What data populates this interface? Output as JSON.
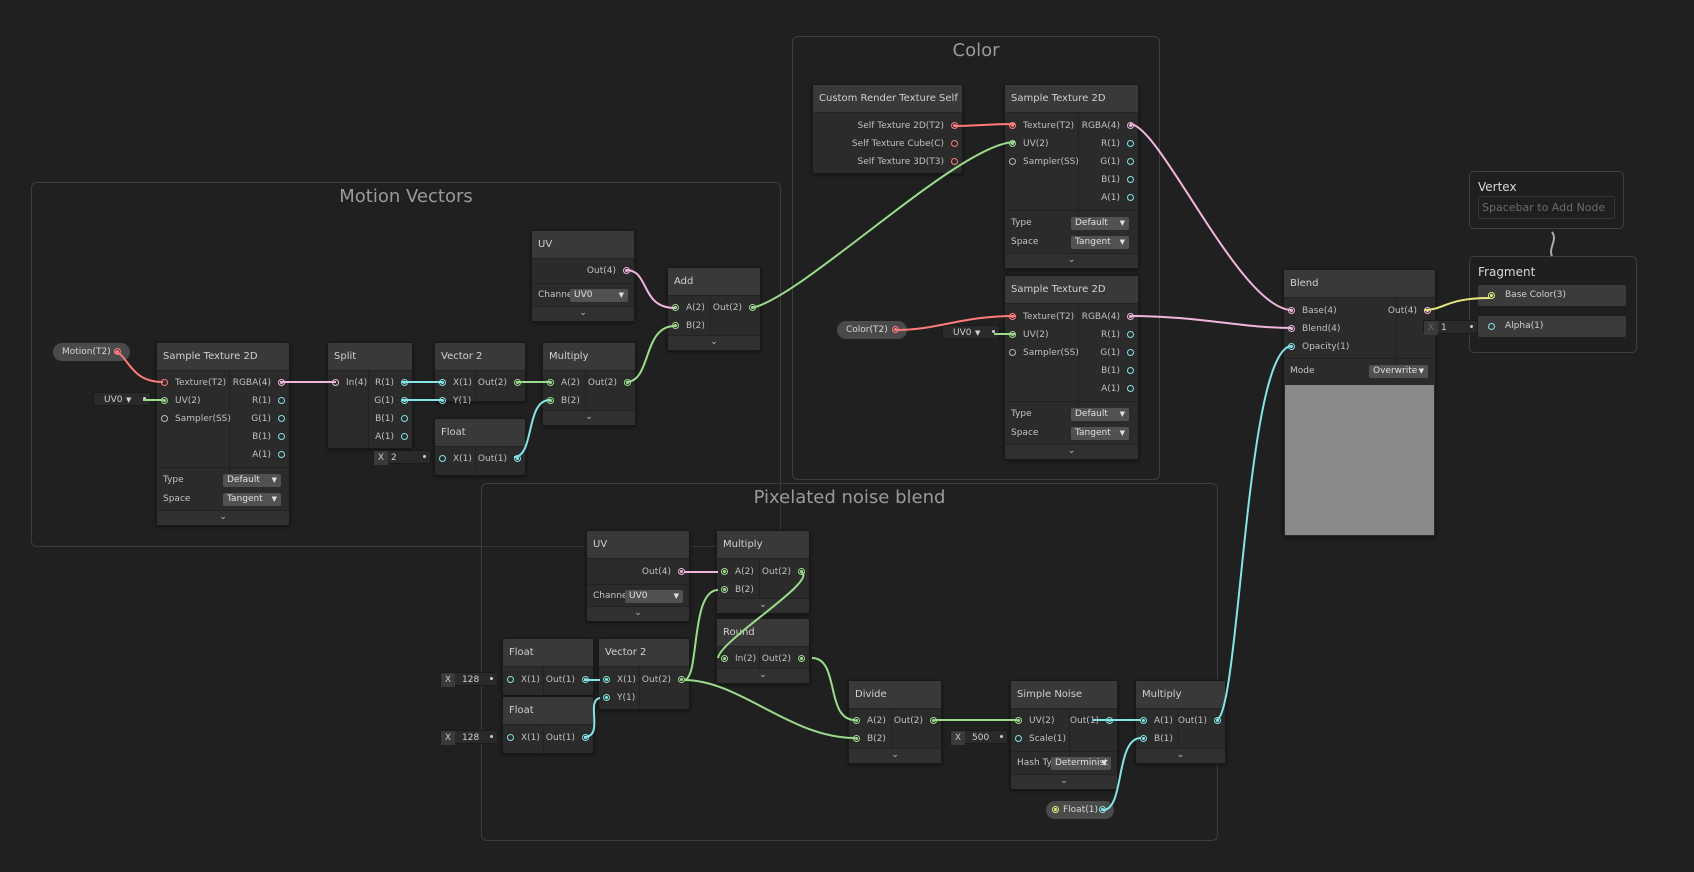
{
  "groups": {
    "motion": "Motion Vectors",
    "color": "Color",
    "pixel": "Pixelated noise blend"
  },
  "colors": {
    "background": "#202020",
    "texture": "#ff7b7b",
    "vector4": "#f0b6de",
    "vector2": "#9bdc8c",
    "vector1": "#84e4e7",
    "vector3": "#e6e87c"
  },
  "icons": {
    "expand": "chevron-down-icon",
    "dropdown": "dropdown-arrow-icon",
    "port": "port-dot-icon"
  },
  "nodes": {
    "motion_sample": {
      "title": "Sample Texture 2D",
      "in": [
        "Texture(T2)",
        "UV(2)",
        "Sampler(SS)"
      ],
      "out": [
        "RGBA(4)",
        "R(1)",
        "G(1)",
        "B(1)",
        "A(1)"
      ],
      "type_label": "Type",
      "type_value": "Default",
      "space_label": "Space",
      "space_value": "Tangent"
    },
    "split": {
      "title": "Split",
      "in": [
        "In(4)"
      ],
      "out": [
        "R(1)",
        "G(1)",
        "B(1)",
        "A(1)"
      ]
    },
    "vec2_a": {
      "title": "Vector 2",
      "in": [
        "X(1)",
        "Y(1)"
      ],
      "out": [
        "Out(2)"
      ]
    },
    "float_a": {
      "title": "Float",
      "in": [
        "X(1)"
      ],
      "out": [
        "Out(1)"
      ]
    },
    "mult_a": {
      "title": "Multiply",
      "in": [
        "A(2)",
        "B(2)"
      ],
      "out": [
        "Out(2)"
      ]
    },
    "uv_a": {
      "title": "UV",
      "out": [
        "Out(4)"
      ],
      "channel_label": "Channe",
      "channel_value": "UV0"
    },
    "add": {
      "title": "Add",
      "in": [
        "A(2)",
        "B(2)"
      ],
      "out": [
        "Out(2)"
      ]
    },
    "crt_self": {
      "title": "Custom Render Texture Self",
      "out": [
        "Self Texture 2D(T2)",
        "Self Texture Cube(C)",
        "Self Texture 3D(T3)"
      ]
    },
    "color_sample1": {
      "title": "Sample Texture 2D",
      "in": [
        "Texture(T2)",
        "UV(2)",
        "Sampler(SS)"
      ],
      "out": [
        "RGBA(4)",
        "R(1)",
        "G(1)",
        "B(1)",
        "A(1)"
      ],
      "type_label": "Type",
      "type_value": "Default",
      "space_label": "Space",
      "space_value": "Tangent"
    },
    "color_sample2": {
      "title": "Sample Texture 2D",
      "in": [
        "Texture(T2)",
        "UV(2)",
        "Sampler(SS)"
      ],
      "out": [
        "RGBA(4)",
        "R(1)",
        "G(1)",
        "B(1)",
        "A(1)"
      ],
      "type_label": "Type",
      "type_value": "Default",
      "space_label": "Space",
      "space_value": "Tangent"
    },
    "blend": {
      "title": "Blend",
      "in": [
        "Base(4)",
        "Blend(4)",
        "Opacity(1)"
      ],
      "out": [
        "Out(4)"
      ],
      "mode_label": "Mode",
      "mode_value": "Overwrite"
    },
    "uv_b": {
      "title": "UV",
      "out": [
        "Out(4)"
      ],
      "channel_label": "Channe",
      "channel_value": "UV0"
    },
    "mult_b": {
      "title": "Multiply",
      "in": [
        "A(2)",
        "B(2)"
      ],
      "out": [
        "Out(2)"
      ]
    },
    "round": {
      "title": "Round",
      "in": [
        "In(2)"
      ],
      "out": [
        "Out(2)"
      ]
    },
    "float_b": {
      "title": "Float",
      "in": [
        "X(1)"
      ],
      "out": [
        "Out(1)"
      ]
    },
    "float_c": {
      "title": "Float",
      "in": [
        "X(1)"
      ],
      "out": [
        "Out(1)"
      ]
    },
    "vec2_b": {
      "title": "Vector 2",
      "in": [
        "X(1)",
        "Y(1)"
      ],
      "out": [
        "Out(2)"
      ]
    },
    "divide": {
      "title": "Divide",
      "in": [
        "A(2)",
        "B(2)"
      ],
      "out": [
        "Out(2)"
      ]
    },
    "noise": {
      "title": "Simple Noise",
      "in": [
        "UV(2)",
        "Scale(1)"
      ],
      "out": [
        "Out(1)"
      ],
      "hash_label": "Hash Ty",
      "hash_value": "Determinist"
    },
    "mult_c": {
      "title": "Multiply",
      "in": [
        "A(1)",
        "B(1)"
      ],
      "out": [
        "Out(1)"
      ]
    }
  },
  "properties": {
    "motion": "Motion(T2)",
    "color": "Color(T2)",
    "float": "Float(1)"
  },
  "inline_values": {
    "uv0_a": "UV0",
    "uv0_b": "UV0",
    "x_label": "X",
    "float_a": "2",
    "float_b": "128",
    "float_c": "128",
    "scale": "500",
    "alpha": "1"
  },
  "master": {
    "vertex_title": "Vertex",
    "vertex_placeholder": "Spacebar to Add Node",
    "fragment_title": "Fragment",
    "fragment_blocks": [
      "Base Color(3)",
      "Alpha(1)"
    ]
  }
}
